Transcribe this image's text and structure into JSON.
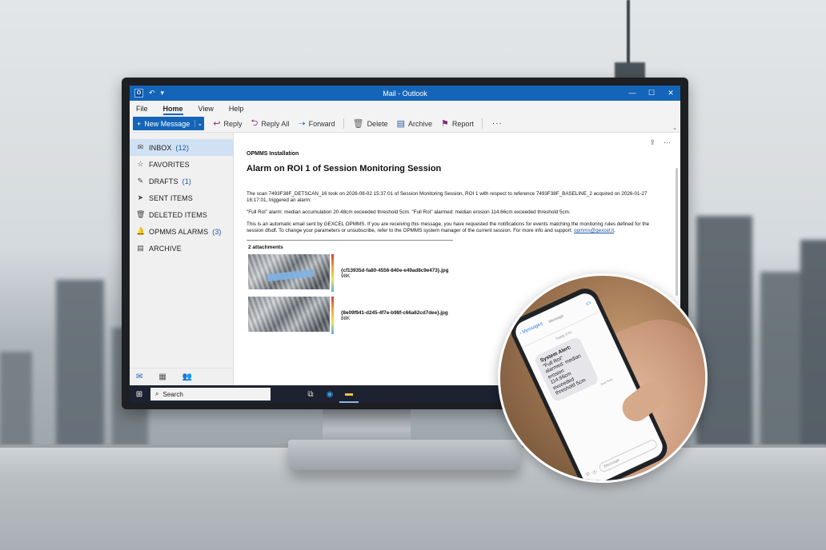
{
  "window": {
    "title": "Mail - Outlook",
    "controls": [
      "—",
      "☐",
      "✕"
    ]
  },
  "menu": {
    "tabs": [
      "File",
      "Home",
      "View",
      "Help"
    ],
    "active": "Home"
  },
  "ribbon": {
    "new_message": "New Message",
    "reply": "Reply",
    "reply_all": "Reply All",
    "forward": "Forward",
    "delete": "Delete",
    "archive": "Archive",
    "report": "Report",
    "more": "···"
  },
  "folders": [
    {
      "label": "INBOX",
      "count": "(12)",
      "icon": "inbox-icon"
    },
    {
      "label": "FAVORITES",
      "count": "",
      "icon": "star-icon"
    },
    {
      "label": "DRAFTS",
      "count": "(1)",
      "icon": "pencil-icon"
    },
    {
      "label": "SENT ITEMS",
      "count": "",
      "icon": "send-icon"
    },
    {
      "label": "DELETED ITEMS",
      "count": "",
      "icon": "trash-icon"
    },
    {
      "label": "OPMMS ALARMS",
      "count": "(3)",
      "icon": "bell-icon"
    },
    {
      "label": "ARCHIVE",
      "count": "",
      "icon": "archive-icon"
    }
  ],
  "email": {
    "sender": "OPMMS Installation",
    "subject": "Alarm on ROI 1 of Session Monitoring Session",
    "para1": "The scan 7493F38F_DETSCAN_16 took on 2026-08-02 15:37:01 of Session Monitoring Session, ROI 1 with respect to reference 7493F38F_BASELINE_2 acquired on 2026-01-27 16:17:01, triggered an alarm:",
    "para2": "\"Full RoI\" alarm: median accumulation 20.48cm exceeded threshold 5cm. \"Full RoI\" alarmed: median erosion 114.66cm exceeded threshold 5cm.",
    "para3": " This is an automatic email sent by GEXCEL OPMMS. If you are receiving this message, you have requested the notifications for events matching the monitoring rules defined for the session dfsdf. To change your parameters or unsubscribe, refer to the OPMMS system manager of the current session. For more info and support: ",
    "support_email": "opmms@gexcel.it",
    "para3_end": ".",
    "attachments_title": "2 attachments",
    "attachments": [
      {
        "name": "{cf13935d-fa80-4556-840e-e49ad8c9e473}.jpg",
        "size": "98K"
      },
      {
        "name": "{8e09f941-d245-4f7e-b98f-c66a62cd7dee}.jpg",
        "size": "88K"
      }
    ]
  },
  "taskbar": {
    "search_label": "Search"
  },
  "phone": {
    "header": "Messages",
    "contact": "Message",
    "date": "Today 9:41",
    "alert_title": "System Alert:",
    "alert_body": "\"Full RoI\" alarmed: median erosion 114.66cm exceeded threshold 5cm",
    "time": "Just Now",
    "input_placeholder": "iMessage"
  },
  "colors": {
    "accent": "#1465b8",
    "inbox_highlight": "#cfe1f3",
    "link": "#1a56a6"
  }
}
